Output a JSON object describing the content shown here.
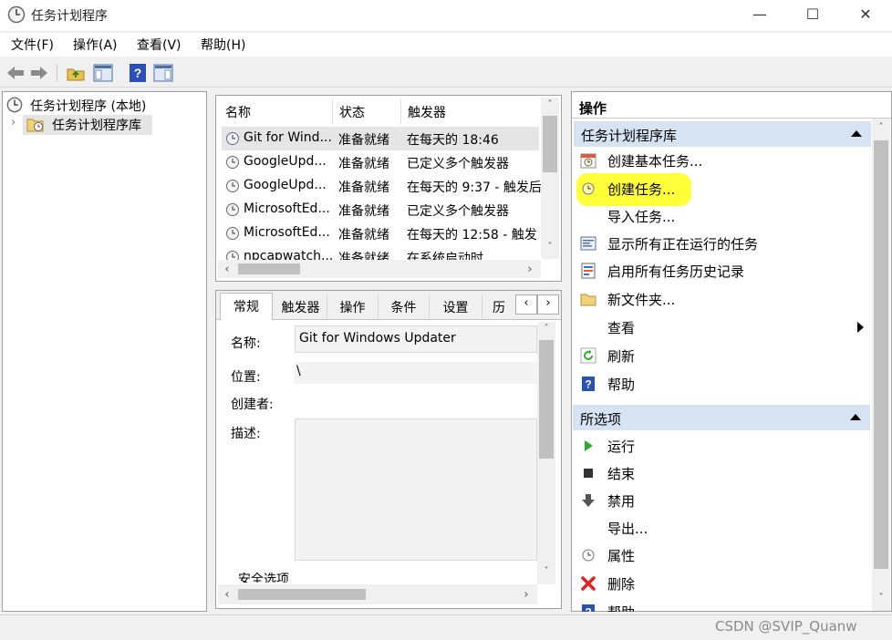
{
  "window": {
    "title": "任务计划程序",
    "controls": {
      "minimize": "—",
      "maximize": "☐",
      "close": "✕"
    }
  },
  "menu": [
    "文件(F)",
    "操作(A)",
    "查看(V)",
    "帮助(H)"
  ],
  "tree": {
    "root": "任务计划程序 (本地)",
    "child": "任务计划程序库",
    "expander": "›"
  },
  "list": {
    "columns": [
      "名称",
      "状态",
      "触发器"
    ],
    "rows": [
      {
        "name": "Git for Wind...",
        "status": "准备就绪",
        "trigger": "在每天的 18:46"
      },
      {
        "name": "GoogleUpd...",
        "status": "准备就绪",
        "trigger": "已定义多个触发器"
      },
      {
        "name": "GoogleUpd...",
        "status": "准备就绪",
        "trigger": "在每天的 9:37 - 触发后"
      },
      {
        "name": "MicrosoftEd...",
        "status": "准备就绪",
        "trigger": "已定义多个触发器"
      },
      {
        "name": "MicrosoftEd...",
        "status": "准备就绪",
        "trigger": "在每天的 12:58 - 触发"
      },
      {
        "name": "npcapwatch...",
        "status": "准备就绪",
        "trigger": "在系统启动时"
      }
    ]
  },
  "detail": {
    "tabs": [
      "常规",
      "触发器",
      "操作",
      "条件",
      "设置",
      "历"
    ],
    "tab_scroll": {
      "left": "‹",
      "right": "›"
    },
    "fields": {
      "name_label": "名称:",
      "name_value": "Git for Windows Updater",
      "location_label": "位置:",
      "location_value": "\\",
      "author_label": "创建者:",
      "description_label": "描述:",
      "security_label": "安全选项"
    }
  },
  "actions": {
    "header": "操作",
    "library_section": "任务计划程序库",
    "library_items": [
      "创建基本任务...",
      "创建任务...",
      "导入任务...",
      "显示所有正在运行的任务",
      "启用所有任务历史记录",
      "新文件夹...",
      "查看",
      "刷新",
      "帮助"
    ],
    "selected_section": "所选项",
    "selected_items": [
      "运行",
      "结束",
      "禁用",
      "导出...",
      "属性",
      "删除",
      "帮助"
    ]
  },
  "scroll_arrows": {
    "up": "˄",
    "down": "˅",
    "left": "‹",
    "right": "›"
  },
  "watermark": "CSDN @SVIP_Quanw",
  "colors": {
    "section_header": "#d6e3f3",
    "highlight": "#ffff3a",
    "selected_row": "#e5e5e5",
    "run_green": "#2eaa2e",
    "delete_red": "#e02020",
    "help_blue": "#2a4fb5"
  }
}
